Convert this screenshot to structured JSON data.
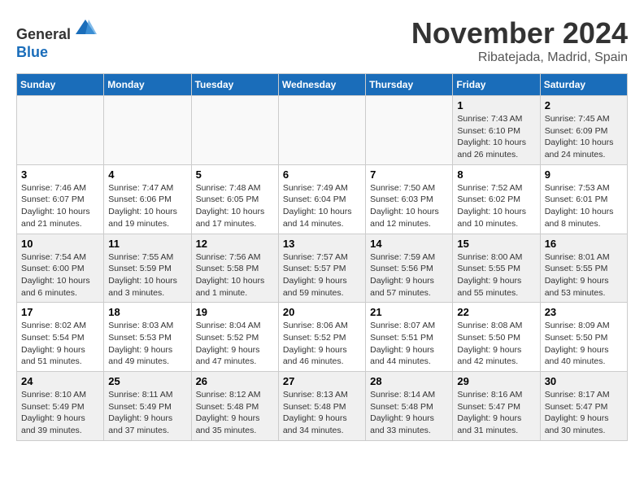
{
  "header": {
    "logo_line1": "General",
    "logo_line2": "Blue",
    "month": "November 2024",
    "location": "Ribatejada, Madrid, Spain"
  },
  "weekdays": [
    "Sunday",
    "Monday",
    "Tuesday",
    "Wednesday",
    "Thursday",
    "Friday",
    "Saturday"
  ],
  "weeks": [
    [
      {
        "day": "",
        "info": ""
      },
      {
        "day": "",
        "info": ""
      },
      {
        "day": "",
        "info": ""
      },
      {
        "day": "",
        "info": ""
      },
      {
        "day": "",
        "info": ""
      },
      {
        "day": "1",
        "info": "Sunrise: 7:43 AM\nSunset: 6:10 PM\nDaylight: 10 hours\nand 26 minutes."
      },
      {
        "day": "2",
        "info": "Sunrise: 7:45 AM\nSunset: 6:09 PM\nDaylight: 10 hours\nand 24 minutes."
      }
    ],
    [
      {
        "day": "3",
        "info": "Sunrise: 7:46 AM\nSunset: 6:07 PM\nDaylight: 10 hours\nand 21 minutes."
      },
      {
        "day": "4",
        "info": "Sunrise: 7:47 AM\nSunset: 6:06 PM\nDaylight: 10 hours\nand 19 minutes."
      },
      {
        "day": "5",
        "info": "Sunrise: 7:48 AM\nSunset: 6:05 PM\nDaylight: 10 hours\nand 17 minutes."
      },
      {
        "day": "6",
        "info": "Sunrise: 7:49 AM\nSunset: 6:04 PM\nDaylight: 10 hours\nand 14 minutes."
      },
      {
        "day": "7",
        "info": "Sunrise: 7:50 AM\nSunset: 6:03 PM\nDaylight: 10 hours\nand 12 minutes."
      },
      {
        "day": "8",
        "info": "Sunrise: 7:52 AM\nSunset: 6:02 PM\nDaylight: 10 hours\nand 10 minutes."
      },
      {
        "day": "9",
        "info": "Sunrise: 7:53 AM\nSunset: 6:01 PM\nDaylight: 10 hours\nand 8 minutes."
      }
    ],
    [
      {
        "day": "10",
        "info": "Sunrise: 7:54 AM\nSunset: 6:00 PM\nDaylight: 10 hours\nand 6 minutes."
      },
      {
        "day": "11",
        "info": "Sunrise: 7:55 AM\nSunset: 5:59 PM\nDaylight: 10 hours\nand 3 minutes."
      },
      {
        "day": "12",
        "info": "Sunrise: 7:56 AM\nSunset: 5:58 PM\nDaylight: 10 hours\nand 1 minute."
      },
      {
        "day": "13",
        "info": "Sunrise: 7:57 AM\nSunset: 5:57 PM\nDaylight: 9 hours\nand 59 minutes."
      },
      {
        "day": "14",
        "info": "Sunrise: 7:59 AM\nSunset: 5:56 PM\nDaylight: 9 hours\nand 57 minutes."
      },
      {
        "day": "15",
        "info": "Sunrise: 8:00 AM\nSunset: 5:55 PM\nDaylight: 9 hours\nand 55 minutes."
      },
      {
        "day": "16",
        "info": "Sunrise: 8:01 AM\nSunset: 5:55 PM\nDaylight: 9 hours\nand 53 minutes."
      }
    ],
    [
      {
        "day": "17",
        "info": "Sunrise: 8:02 AM\nSunset: 5:54 PM\nDaylight: 9 hours\nand 51 minutes."
      },
      {
        "day": "18",
        "info": "Sunrise: 8:03 AM\nSunset: 5:53 PM\nDaylight: 9 hours\nand 49 minutes."
      },
      {
        "day": "19",
        "info": "Sunrise: 8:04 AM\nSunset: 5:52 PM\nDaylight: 9 hours\nand 47 minutes."
      },
      {
        "day": "20",
        "info": "Sunrise: 8:06 AM\nSunset: 5:52 PM\nDaylight: 9 hours\nand 46 minutes."
      },
      {
        "day": "21",
        "info": "Sunrise: 8:07 AM\nSunset: 5:51 PM\nDaylight: 9 hours\nand 44 minutes."
      },
      {
        "day": "22",
        "info": "Sunrise: 8:08 AM\nSunset: 5:50 PM\nDaylight: 9 hours\nand 42 minutes."
      },
      {
        "day": "23",
        "info": "Sunrise: 8:09 AM\nSunset: 5:50 PM\nDaylight: 9 hours\nand 40 minutes."
      }
    ],
    [
      {
        "day": "24",
        "info": "Sunrise: 8:10 AM\nSunset: 5:49 PM\nDaylight: 9 hours\nand 39 minutes."
      },
      {
        "day": "25",
        "info": "Sunrise: 8:11 AM\nSunset: 5:49 PM\nDaylight: 9 hours\nand 37 minutes."
      },
      {
        "day": "26",
        "info": "Sunrise: 8:12 AM\nSunset: 5:48 PM\nDaylight: 9 hours\nand 35 minutes."
      },
      {
        "day": "27",
        "info": "Sunrise: 8:13 AM\nSunset: 5:48 PM\nDaylight: 9 hours\nand 34 minutes."
      },
      {
        "day": "28",
        "info": "Sunrise: 8:14 AM\nSunset: 5:48 PM\nDaylight: 9 hours\nand 33 minutes."
      },
      {
        "day": "29",
        "info": "Sunrise: 8:16 AM\nSunset: 5:47 PM\nDaylight: 9 hours\nand 31 minutes."
      },
      {
        "day": "30",
        "info": "Sunrise: 8:17 AM\nSunset: 5:47 PM\nDaylight: 9 hours\nand 30 minutes."
      }
    ]
  ]
}
